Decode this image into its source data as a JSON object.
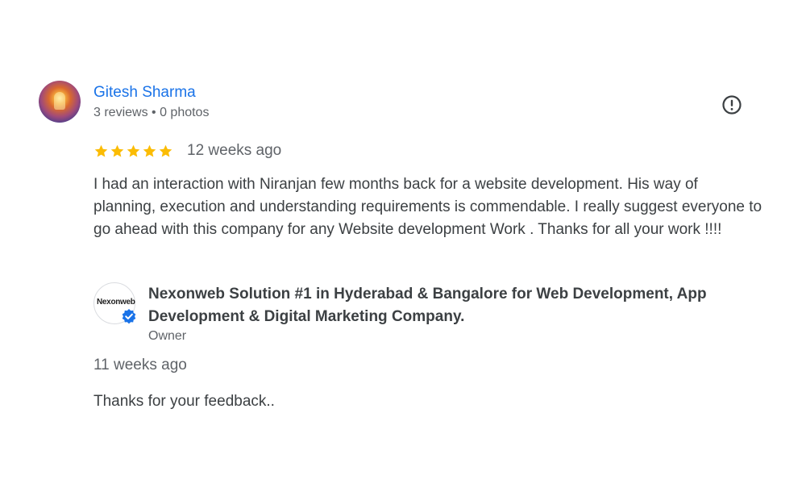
{
  "review": {
    "reviewer": {
      "name": "Gitesh Sharma",
      "meta": "3 reviews • 0 photos",
      "avatar_icon": "profile-photo"
    },
    "rating": {
      "stars": 5,
      "max": 5,
      "color": "#fbbc04"
    },
    "date": "12 weeks ago",
    "text": "I had an interaction with Niranjan few months back for a website development. His way of planning, execution and understanding requirements is commendable. I really suggest everyone to go ahead with this company for any Website development Work . Thanks for all your work !!!!",
    "flag_icon": "report-flag-icon"
  },
  "owner_reply": {
    "logo_text_main": "Nexonweb",
    "logo_badge_icon": "verified-check-icon",
    "name": "Nexonweb Solution #1 in Hyderabad & Bangalore for Web Development, App Development & Digital Marketing Company.",
    "role": "Owner",
    "date": "11 weeks ago",
    "text": "Thanks for your feedback.."
  },
  "colors": {
    "link": "#1a73e8",
    "text": "#3c4043",
    "secondary": "#5f6368",
    "star": "#fbbc04",
    "verified": "#1a73e8"
  }
}
